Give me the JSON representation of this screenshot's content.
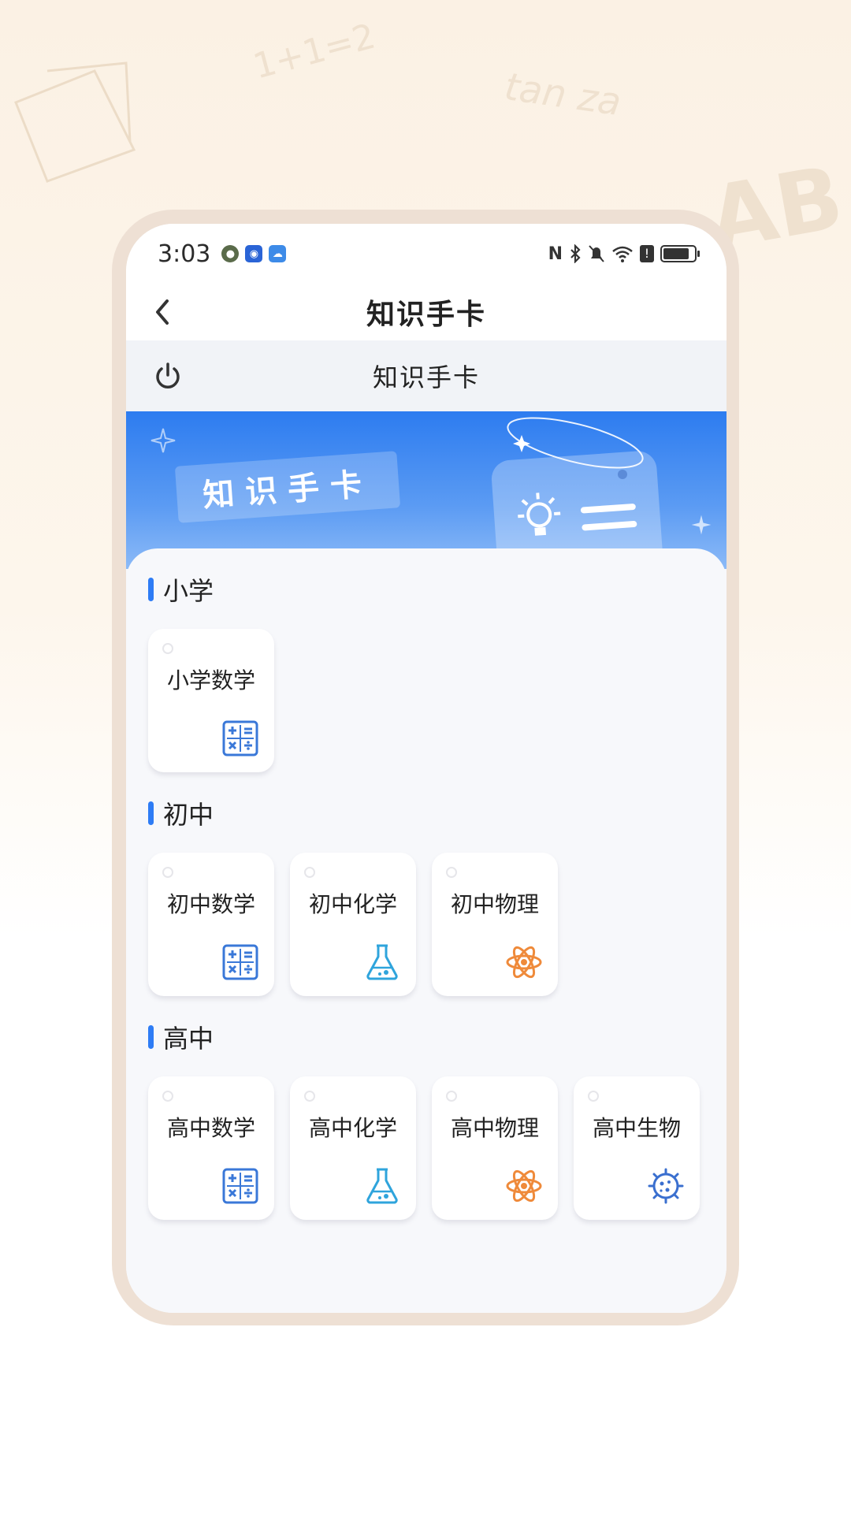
{
  "status_bar": {
    "time": "3:03",
    "battery_level": 0.85
  },
  "nav": {
    "title": "知识手卡",
    "back_icon": "chevron-left-icon"
  },
  "sub_header": {
    "title": "知识手卡",
    "power_icon": "power-icon"
  },
  "banner": {
    "tag_text": "知识手卡",
    "colors": {
      "top": "#2d7cf0",
      "bottom": "#8cbaf7"
    }
  },
  "accent_color": "#2e7cf5",
  "sections": [
    {
      "title": "小学",
      "cards": [
        {
          "label": "小学数学",
          "icon": "calculator-icon"
        }
      ]
    },
    {
      "title": "初中",
      "cards": [
        {
          "label": "初中数学",
          "icon": "calculator-icon"
        },
        {
          "label": "初中化学",
          "icon": "flask-icon"
        },
        {
          "label": "初中物理",
          "icon": "atom-icon"
        }
      ]
    },
    {
      "title": "高中",
      "cards": [
        {
          "label": "高中数学",
          "icon": "calculator-icon"
        },
        {
          "label": "高中化学",
          "icon": "flask-icon"
        },
        {
          "label": "高中物理",
          "icon": "atom-icon"
        },
        {
          "label": "高中生物",
          "icon": "cell-icon"
        }
      ]
    }
  ],
  "background_doodle": "tan za"
}
